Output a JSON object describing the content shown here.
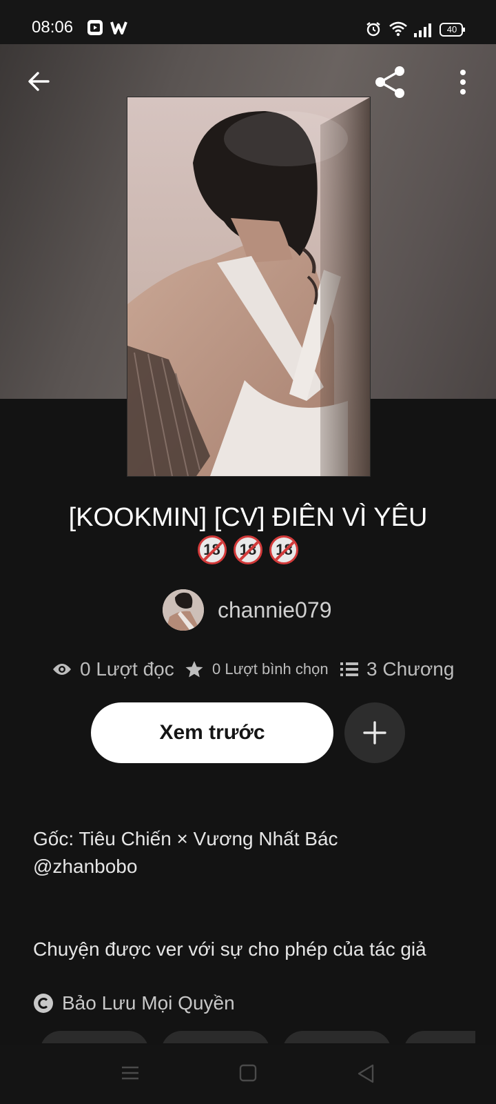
{
  "status_bar": {
    "time": "08:06",
    "battery": "40",
    "app_icons": [
      "youtube-icon",
      "w-app-icon"
    ],
    "system_icons": [
      "alarm-icon",
      "wifi-icon",
      "signal-icon",
      "battery-icon"
    ]
  },
  "top_bar": {
    "back_icon": "arrow-left-icon",
    "share_icon": "share-icon",
    "more_icon": "more-vertical-icon"
  },
  "story": {
    "title": "[KOOKMIN] [CV] ĐIÊN VÌ YÊU",
    "badges": [
      "18",
      "18",
      "18"
    ],
    "author": "channie079"
  },
  "stats": {
    "reads": "0 Lượt đọc",
    "votes": "0 Lượt bình chọn",
    "chapters": "3 Chương"
  },
  "actions": {
    "preview_label": "Xem trước",
    "add_icon": "plus-icon"
  },
  "description": {
    "line1": "Gốc: Tiêu Chiến × Vương Nhất Bác",
    "line2": "@zhanbobo",
    "line3": "Chuyện được ver với sự cho phép của tác giả"
  },
  "copyright": "Bảo Lưu Mọi Quyền",
  "colors": {
    "background": "#131313",
    "primary_button": "#ffffff",
    "secondary_button": "#2d2d2d"
  }
}
